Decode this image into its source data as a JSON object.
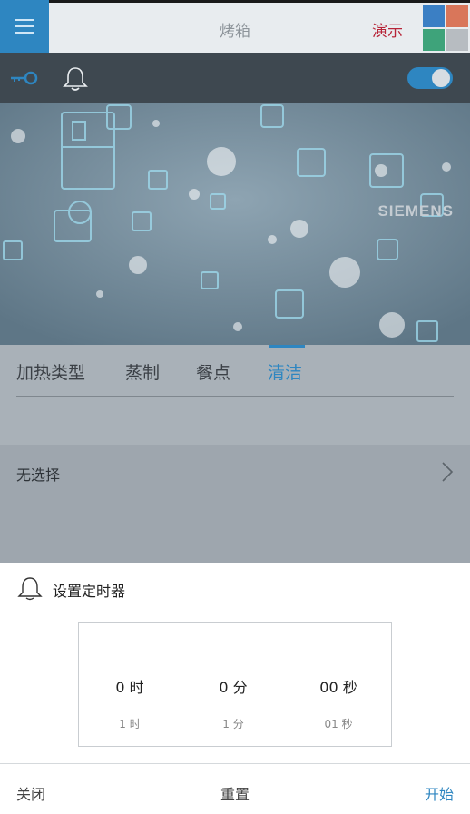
{
  "header": {
    "menu_icon": "hamburger-icon",
    "title": "烤箱",
    "demo_label": "演示",
    "tile_colors": [
      "#3b7fc4",
      "#d9765a",
      "#3ea37a",
      "#b7bcc1"
    ]
  },
  "toolbar": {
    "key_icon": "key-icon",
    "bell_icon": "bell-icon",
    "toggle_on": true
  },
  "hero": {
    "brand": "SIEMENS"
  },
  "tabs": [
    {
      "label": "加热类型",
      "active": false
    },
    {
      "label": "蒸制",
      "active": false
    },
    {
      "label": "餐点",
      "active": false
    },
    {
      "label": "清洁",
      "active": true
    }
  ],
  "section": {
    "label": "无选择"
  },
  "timer": {
    "title": "设置定时器",
    "hours": {
      "value": "0",
      "unit": "时",
      "next_value": "1",
      "next_unit": "时"
    },
    "minutes": {
      "value": "0",
      "unit": "分",
      "next_value": "1",
      "next_unit": "分"
    },
    "seconds": {
      "value": "00",
      "unit": "秒",
      "next_value": "01",
      "next_unit": "秒"
    }
  },
  "actions": {
    "close": "关闭",
    "reset": "重置",
    "start": "开始"
  },
  "colors": {
    "accent": "#2e86c1",
    "demo": "#b72438"
  }
}
